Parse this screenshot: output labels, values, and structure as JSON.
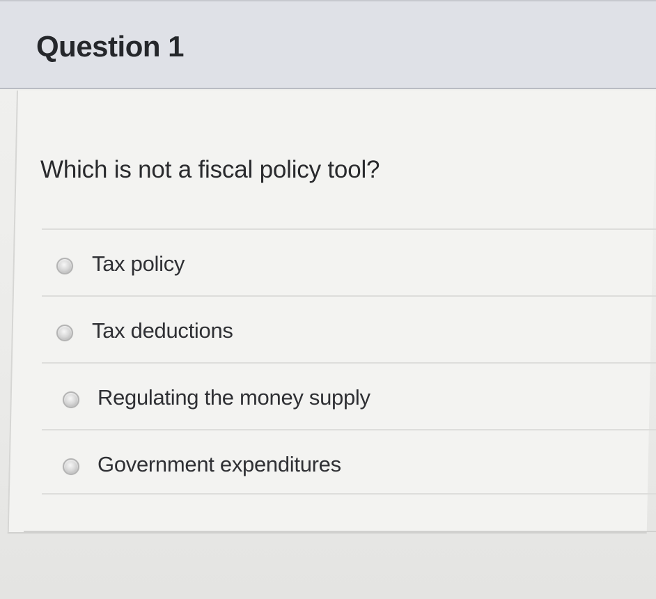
{
  "question": {
    "title": "Question 1",
    "text": "Which is not a fiscal policy tool?",
    "options": [
      {
        "label": "Tax policy"
      },
      {
        "label": "Tax deductions"
      },
      {
        "label": "Regulating the money supply"
      },
      {
        "label": "Government expenditures"
      }
    ]
  },
  "colors": {
    "header_background": "#dfe1e7",
    "body_background": "#f3f3f1",
    "text": "#292a2d",
    "radio": "#c9c9c9"
  },
  "icons": {
    "option_marker": "radio-button-icon"
  }
}
